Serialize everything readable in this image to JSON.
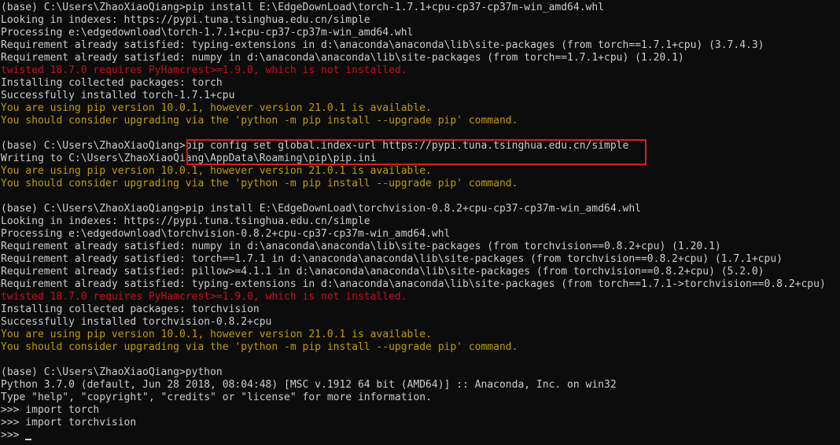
{
  "terminal": {
    "lines": [
      {
        "text": "(base) C:\\Users\\ZhaoXiaoQiang>pip install E:\\EdgeDownLoad\\torch-1.7.1+cpu-cp37-cp37m-win_amd64.whl",
        "kind": "normal"
      },
      {
        "text": "Looking in indexes: https://pypi.tuna.tsinghua.edu.cn/simple",
        "kind": "normal"
      },
      {
        "text": "Processing e:\\edgedownload\\torch-1.7.1+cpu-cp37-cp37m-win_amd64.whl",
        "kind": "normal"
      },
      {
        "text": "Requirement already satisfied: typing-extensions in d:\\anaconda\\anaconda\\lib\\site-packages (from torch==1.7.1+cpu) (3.7.4.3)",
        "kind": "normal"
      },
      {
        "text": "Requirement already satisfied: numpy in d:\\anaconda\\anaconda\\lib\\site-packages (from torch==1.7.1+cpu) (1.20.1)",
        "kind": "normal"
      },
      {
        "text": "twisted 18.7.0 requires PyHamcrest>=1.9.0, which is not installed.",
        "kind": "red"
      },
      {
        "text": "Installing collected packages: torch",
        "kind": "normal"
      },
      {
        "text": "Successfully installed torch-1.7.1+cpu",
        "kind": "normal"
      },
      {
        "text": "You are using pip version 10.0.1, however version 21.0.1 is available.",
        "kind": "yellow"
      },
      {
        "text": "You should consider upgrading via the 'python -m pip install --upgrade pip' command.",
        "kind": "yellow"
      },
      {
        "text": "",
        "kind": "blank"
      },
      {
        "text": "(base) C:\\Users\\ZhaoXiaoQiang>pip config set global.index-url https://pypi.tuna.tsinghua.edu.cn/simple",
        "kind": "normal"
      },
      {
        "text": "Writing to C:\\Users\\ZhaoXiaoQiang\\AppData\\Roaming\\pip\\pip.ini",
        "kind": "normal"
      },
      {
        "text": "You are using pip version 10.0.1, however version 21.0.1 is available.",
        "kind": "yellow"
      },
      {
        "text": "You should consider upgrading via the 'python -m pip install --upgrade pip' command.",
        "kind": "yellow"
      },
      {
        "text": "",
        "kind": "blank"
      },
      {
        "text": "(base) C:\\Users\\ZhaoXiaoQiang>pip install E:\\EdgeDownLoad\\torchvision-0.8.2+cpu-cp37-cp37m-win_amd64.whl",
        "kind": "normal"
      },
      {
        "text": "Looking in indexes: https://pypi.tuna.tsinghua.edu.cn/simple",
        "kind": "normal"
      },
      {
        "text": "Processing e:\\edgedownload\\torchvision-0.8.2+cpu-cp37-cp37m-win_amd64.whl",
        "kind": "normal"
      },
      {
        "text": "Requirement already satisfied: numpy in d:\\anaconda\\anaconda\\lib\\site-packages (from torchvision==0.8.2+cpu) (1.20.1)",
        "kind": "normal"
      },
      {
        "text": "Requirement already satisfied: torch==1.7.1 in d:\\anaconda\\anaconda\\lib\\site-packages (from torchvision==0.8.2+cpu) (1.7.1+cpu)",
        "kind": "normal"
      },
      {
        "text": "Requirement already satisfied: pillow>=4.1.1 in d:\\anaconda\\anaconda\\lib\\site-packages (from torchvision==0.8.2+cpu) (5.2.0)",
        "kind": "normal"
      },
      {
        "text": "Requirement already satisfied: typing-extensions in d:\\anaconda\\anaconda\\lib\\site-packages (from torch==1.7.1->torchvision==0.8.2+cpu)",
        "kind": "normal"
      },
      {
        "text": "twisted 18.7.0 requires PyHamcrest>=1.9.0, which is not installed.",
        "kind": "red"
      },
      {
        "text": "Installing collected packages: torchvision",
        "kind": "normal"
      },
      {
        "text": "Successfully installed torchvision-0.8.2+cpu",
        "kind": "normal"
      },
      {
        "text": "You are using pip version 10.0.1, however version 21.0.1 is available.",
        "kind": "yellow"
      },
      {
        "text": "You should consider upgrading via the 'python -m pip install --upgrade pip' command.",
        "kind": "yellow"
      },
      {
        "text": "",
        "kind": "blank"
      },
      {
        "text": "(base) C:\\Users\\ZhaoXiaoQiang>python",
        "kind": "normal"
      },
      {
        "text": "Python 3.7.0 (default, Jun 28 2018, 08:04:48) [MSC v.1912 64 bit (AMD64)] :: Anaconda, Inc. on win32",
        "kind": "normal"
      },
      {
        "text": "Type \"help\", \"copyright\", \"credits\" or \"license\" for more information.",
        "kind": "normal"
      },
      {
        "text": ">>> import torch",
        "kind": "normal"
      },
      {
        "text": ">>> import torchvision",
        "kind": "normal"
      },
      {
        "text": ">>> ",
        "kind": "prompt"
      }
    ]
  },
  "colors": {
    "background": "#0c0c0c",
    "text": "#cccccc",
    "error": "#c50f1f",
    "warning": "#c19c00",
    "highlight_box": "#e0191f"
  }
}
